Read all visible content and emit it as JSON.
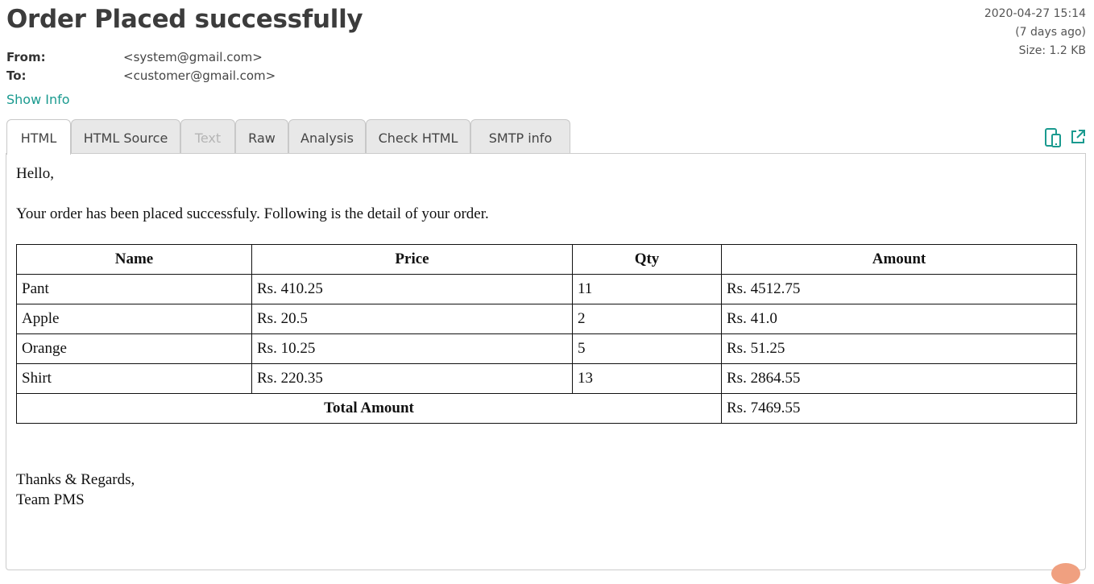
{
  "email": {
    "subject": "Order Placed successfully",
    "date": "2020-04-27 15:14",
    "relative": "(7 days ago)",
    "size": "Size: 1.2 KB",
    "from_label": "From:",
    "from_value": "<system@gmail.com>",
    "to_label": "To:",
    "to_value": "<customer@gmail.com>",
    "show_info": "Show Info"
  },
  "tabs": [
    {
      "label": "HTML",
      "state": "active"
    },
    {
      "label": "HTML Source",
      "state": "normal"
    },
    {
      "label": "Text",
      "state": "disabled"
    },
    {
      "label": "Raw",
      "state": "normal"
    },
    {
      "label": "Analysis",
      "state": "normal"
    },
    {
      "label": "Check HTML",
      "state": "normal"
    },
    {
      "label": "SMTP info",
      "state": "normal"
    }
  ],
  "icons": {
    "responsive": "devices-icon",
    "external": "open-external-icon",
    "accent": "#1a9a8f"
  },
  "body": {
    "greeting": "Hello,",
    "intro": "Your order has been placed successfuly. Following is the detail of your order.",
    "table": {
      "headers": [
        "Name",
        "Price",
        "Qty",
        "Amount"
      ],
      "rows": [
        [
          "Pant",
          "Rs. 410.25",
          "11",
          "Rs. 4512.75"
        ],
        [
          "Apple",
          "Rs. 20.5",
          "2",
          "Rs. 41.0"
        ],
        [
          "Orange",
          "Rs. 10.25",
          "5",
          "Rs. 51.25"
        ],
        [
          "Shirt",
          "Rs. 220.35",
          "13",
          "Rs. 2864.55"
        ]
      ],
      "total_label": "Total Amount",
      "total_value": "Rs. 7469.55"
    },
    "signoff_1": "Thanks & Regards,",
    "signoff_2": "Team PMS"
  }
}
